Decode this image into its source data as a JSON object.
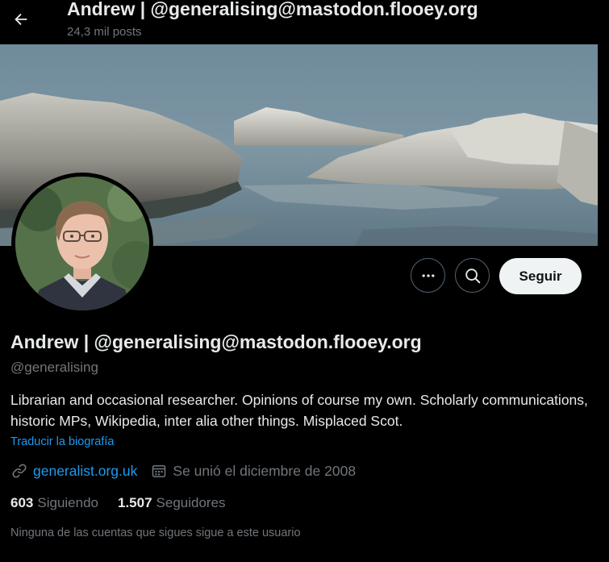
{
  "header": {
    "title": "Andrew | @generalising@mastodon.flooey.org",
    "posts_count": "24,3 mil posts",
    "back_icon": "arrow-left-icon"
  },
  "profile": {
    "display_name": "Andrew | @generalising@mastodon.flooey.org",
    "handle": "@generalising",
    "bio": "Librarian and occasional researcher. Opinions of course my own. Scholarly communications, historic MPs, Wikipedia, inter alia other things. Misplaced Scot.",
    "translate_label": "Traducir la biografía",
    "website": "generalist.org.uk",
    "joined": "Se unió el diciembre de 2008",
    "following_count": "603",
    "following_label": "Siguiendo",
    "followers_count": "1.507",
    "followers_label": "Seguidores",
    "followed_by_note": "Ninguna de las cuentas que sigues sigue a este usuario"
  },
  "actions": {
    "more_icon": "more-dots-icon",
    "search_icon": "search-icon",
    "follow_label": "Seguir"
  },
  "colors": {
    "background": "#000000",
    "text_primary": "#e7e9ea",
    "text_secondary": "#71767b",
    "link": "#1d9bf0",
    "button_border": "#536471",
    "follow_button_bg": "#eff3f4"
  }
}
